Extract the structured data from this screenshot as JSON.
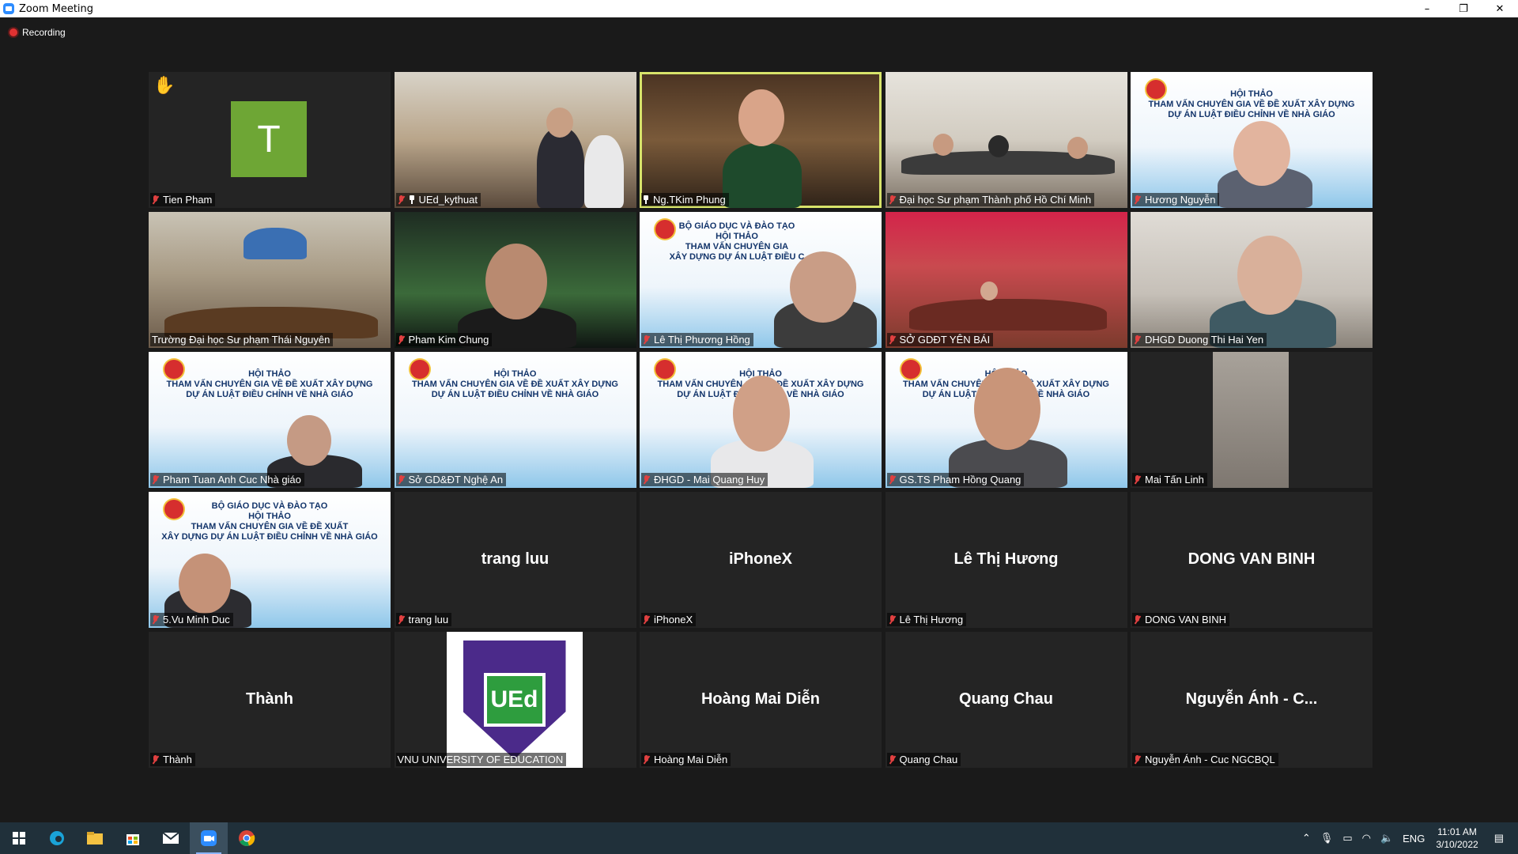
{
  "window": {
    "title": "Zoom Meeting",
    "minimize": "–",
    "restore": "❐",
    "close": "✕"
  },
  "recording": {
    "label": "Recording"
  },
  "tiles": [
    {
      "name": "Tien Pham",
      "avatar_letter": "T",
      "hand_raised": "✋",
      "muted": true
    },
    {
      "name": "UEd_kythuat",
      "muted": true,
      "pinned": true
    },
    {
      "name": "Ng.TKim Phung",
      "pinned": true,
      "active_speaker": true
    },
    {
      "name": "Đại học Sư phạm Thành phố Hồ Chí Minh",
      "muted": true
    },
    {
      "name": "Hương Nguyễn",
      "muted": true,
      "banner_head": "HỘI THẢO\nTHAM VẤN CHUYÊN GIA VỀ ĐỀ XUẤT XÂY DỰNG\nDỰ ÁN LUẬT ĐIỀU CHỈNH VỀ NHÀ GIÁO"
    },
    {
      "name": "Trường Đại học Sư phạm Thái Nguyên"
    },
    {
      "name": "Pham Kim Chung",
      "muted": true
    },
    {
      "name": "Lê Thị Phương Hồng",
      "muted": true,
      "banner_head": "BỘ GIÁO DỤC VÀ ĐÀO TẠO\nHỘI THẢO\nTHAM VẤN CHUYÊN GIA\nXÂY DỰNG DỰ ÁN LUẬT ĐIỀU C"
    },
    {
      "name": "SỞ GDĐT YÊN BÁI",
      "muted": true
    },
    {
      "name": "DHGD Duong Thi Hai Yen",
      "muted": true
    },
    {
      "name": "Pham Tuan Anh Cuc Nhà giáo",
      "muted": true,
      "banner_head": "HỘI THẢO\nTHAM VẤN CHUYÊN GIA VỀ ĐỀ XUẤT XÂY DỰNG\nDỰ ÁN LUẬT ĐIỀU CHỈNH VỀ NHÀ GIÁO"
    },
    {
      "name": "Sở GD&ĐT Nghệ An",
      "muted": true,
      "banner_head": "HỘI THẢO\nTHAM VẤN CHUYÊN GIA VỀ ĐỀ XUẤT XÂY DỰNG\nDỰ ÁN LUẬT ĐIỀU CHỈNH VỀ NHÀ GIÁO"
    },
    {
      "name": "ĐHGD - Mai Quang Huy",
      "muted": true,
      "banner_head": "HỘI THẢO\nTHAM VẤN CHUYÊN GIA VỀ ĐỀ XUẤT XÂY DỰNG\nDỰ ÁN LUẬT ĐIỀU CHỈNH VỀ NHÀ GIÁO"
    },
    {
      "name": "GS.TS Pham Hồng Quang",
      "muted": true,
      "banner_head": "HỘI THẢO\nTHAM VẤN CHUYÊN GIA VỀ ĐỀ XUẤT XÂY DỰNG\nDỰ ÁN LUẬT ĐIỀU CHỈNH VỀ NHÀ GIÁO"
    },
    {
      "name": "Mai Tấn Linh",
      "muted": true
    },
    {
      "name": "5.Vu Minh Duc",
      "muted": true,
      "banner_head": "BỘ GIÁO DỤC VÀ ĐÀO TẠO\nHỘI THẢO\nTHAM VẤN CHUYÊN GIA VỀ ĐỀ XUẤT\nXÂY DỰNG DỰ ÁN LUẬT ĐIỀU CHỈNH VỀ NHÀ GIÁO"
    },
    {
      "name": "trang luu",
      "display_name": "trang luu",
      "muted": true
    },
    {
      "name": "iPhoneX",
      "display_name": "iPhoneX",
      "muted": true
    },
    {
      "name": "Lê Thị Hương",
      "display_name": "Lê Thị Hương",
      "muted": true
    },
    {
      "name": "DONG VAN BINH",
      "display_name": "DONG VAN BINH",
      "muted": true
    },
    {
      "name": "Thành",
      "display_name": "Thành",
      "muted": true
    },
    {
      "name": "VNU UNIVERSITY OF EDUCATION",
      "logo_text": "UEd"
    },
    {
      "name": "Hoàng Mai Diễn",
      "display_name": "Hoàng Mai Diễn",
      "muted": true
    },
    {
      "name": "Quang Chau",
      "display_name": "Quang Chau",
      "muted": true
    },
    {
      "name": "Nguyễn Ánh - Cuc NGCBQL",
      "display_name": "Nguyễn Ánh - C...",
      "muted": true
    }
  ],
  "taskbar": {
    "language": "ENG",
    "time": "11:01 AM",
    "date": "3/10/2022"
  }
}
